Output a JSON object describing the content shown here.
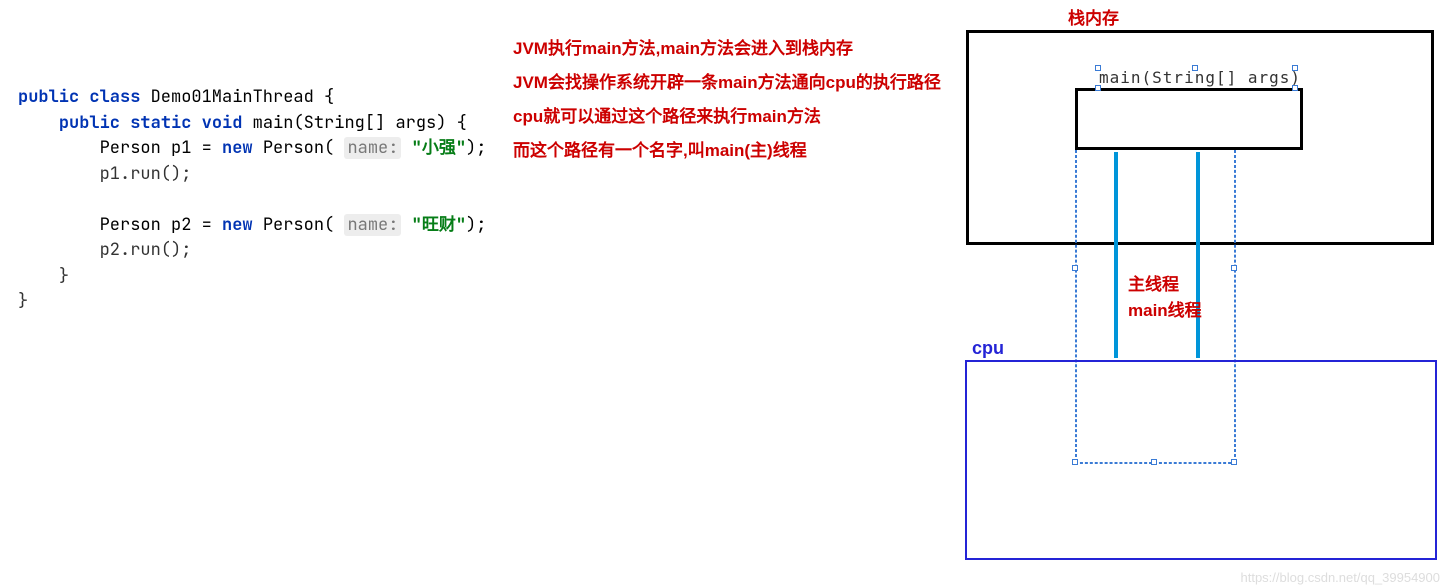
{
  "code": {
    "line1_kw1": "public",
    "line1_kw2": "class",
    "line1_cls": "Demo01MainThread {",
    "line2_kw1": "public",
    "line2_kw2": "static",
    "line2_kw3": "void",
    "line2_sig": "main(String[] args) {",
    "line3_a": "Person p1 = ",
    "line3_kw": "new",
    "line3_b": " Person( ",
    "line3_hint": "name:",
    "line3_str": " \"小强\"",
    "line3_c": ");",
    "line4": "p1.run();",
    "line5_a": "Person p2 = ",
    "line5_kw": "new",
    "line5_b": " Person( ",
    "line5_hint": "name:",
    "line5_str": " \"旺财\"",
    "line5_c": ");",
    "line6": "p2.run();",
    "line7": "}",
    "line8": "}"
  },
  "explain": {
    "l1": "JVM执行main方法,main方法会进入到栈内存",
    "l2": "JVM会找操作系统开辟一条main方法通向cpu的执行路径",
    "l3": "cpu就可以通过这个路径来执行main方法",
    "l4": "而这个路径有一个名字,叫main(主)线程"
  },
  "diagram": {
    "stack_label": "栈内存",
    "main_sig": "main(String[] args)",
    "thread_l1": "主线程",
    "thread_l2": "main线程",
    "cpu_label": "cpu"
  },
  "watermark": "https://blog.csdn.net/qq_39954900"
}
